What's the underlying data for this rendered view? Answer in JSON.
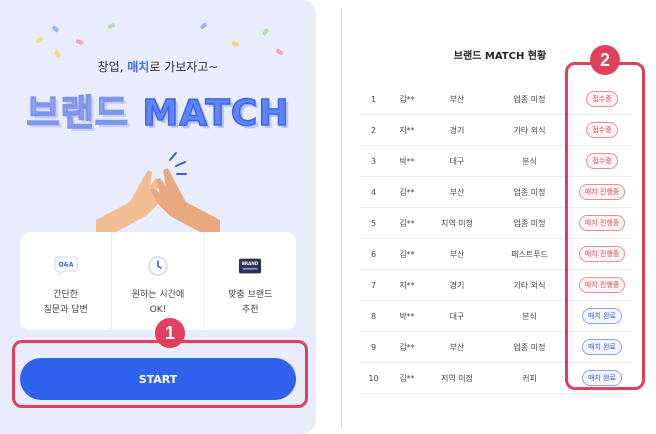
{
  "left_panel": {
    "tagline_prefix": "창업, ",
    "tagline_accent": "매치",
    "tagline_suffix": "로 가보자고~",
    "hero_title_ko": "브랜드",
    "hero_title_en": "MATCH",
    "features": [
      {
        "icon": "qa-bubble-icon",
        "icon_text": "Q&A",
        "label": "간단한\n질문과 답변"
      },
      {
        "icon": "clock-icon",
        "icon_text": "",
        "label": "원하는 시간에\nOK!"
      },
      {
        "icon": "brand-card-icon",
        "icon_text": "BRAND",
        "label": "맞춤 브랜드\n추천"
      }
    ],
    "start_label": "START",
    "callout_1": "1"
  },
  "right_panel": {
    "title": "브랜드 MATCH 현황",
    "callout_2": "2",
    "rows": [
      {
        "no": "1",
        "name": "김**",
        "region": "부산",
        "category": "업종 미정",
        "status": "접수중",
        "status_type": "received"
      },
      {
        "no": "2",
        "name": "지**",
        "region": "경기",
        "category": "기타 외식",
        "status": "접수중",
        "status_type": "received"
      },
      {
        "no": "3",
        "name": "박**",
        "region": "대구",
        "category": "분식",
        "status": "접수중",
        "status_type": "received"
      },
      {
        "no": "4",
        "name": "김**",
        "region": "부산",
        "category": "업종 미정",
        "status": "매치 진행중",
        "status_type": "in_progress"
      },
      {
        "no": "5",
        "name": "김**",
        "region": "지역 미정",
        "category": "업종 미정",
        "status": "매치 진행중",
        "status_type": "in_progress"
      },
      {
        "no": "6",
        "name": "김**",
        "region": "부산",
        "category": "패스트푸드",
        "status": "매치 진행중",
        "status_type": "in_progress"
      },
      {
        "no": "7",
        "name": "지**",
        "region": "경기",
        "category": "기타 외식",
        "status": "매치 진행중",
        "status_type": "in_progress"
      },
      {
        "no": "8",
        "name": "박**",
        "region": "대구",
        "category": "분식",
        "status": "매치 완료",
        "status_type": "done"
      },
      {
        "no": "9",
        "name": "김**",
        "region": "부산",
        "category": "업종 미정",
        "status": "매치 완료",
        "status_type": "done"
      },
      {
        "no": "10",
        "name": "김**",
        "region": "지역 미정",
        "category": "커피",
        "status": "매치 완료",
        "status_type": "done"
      }
    ]
  },
  "colors": {
    "primary": "#2f63ee",
    "callout": "#e13f5b",
    "panel_bg": "#e9edfb",
    "status_red": "#e5485e",
    "status_blue": "#3b5bd8"
  }
}
